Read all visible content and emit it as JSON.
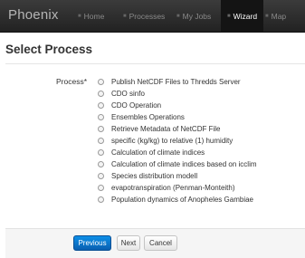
{
  "navbar": {
    "brand": "Phoenix",
    "items": [
      {
        "label": "Home",
        "icon": "home-icon"
      },
      {
        "label": "Processes",
        "icon": "cog-icon"
      },
      {
        "label": "My Jobs",
        "icon": "list-icon"
      },
      {
        "label": "Wizard",
        "icon": "magic-icon",
        "active": true
      },
      {
        "label": "Map",
        "icon": "globe-icon"
      }
    ]
  },
  "page": {
    "title": "Select Process"
  },
  "form": {
    "field_label": "Process*",
    "options": [
      "Publish NetCDF Files to Thredds Server",
      "CDO sinfo",
      "CDO Operation",
      "Ensembles Operations",
      "Retrieve Metadata of NetCDF File",
      "specific (kg/kg) to relative (1) humidity",
      "Calculation of climate indices",
      "Calculation of climate indices based on icclim",
      "Species distribution modell",
      "evapotranspiration (Penman-Monteith)",
      "Population dynamics of Anopheles Gambiae"
    ]
  },
  "buttons": {
    "previous": "Previous",
    "next": "Next",
    "cancel": "Cancel"
  },
  "colors": {
    "navbar": "#222222",
    "primary": "#0a6ec9",
    "footer": "#f5f5f5"
  }
}
